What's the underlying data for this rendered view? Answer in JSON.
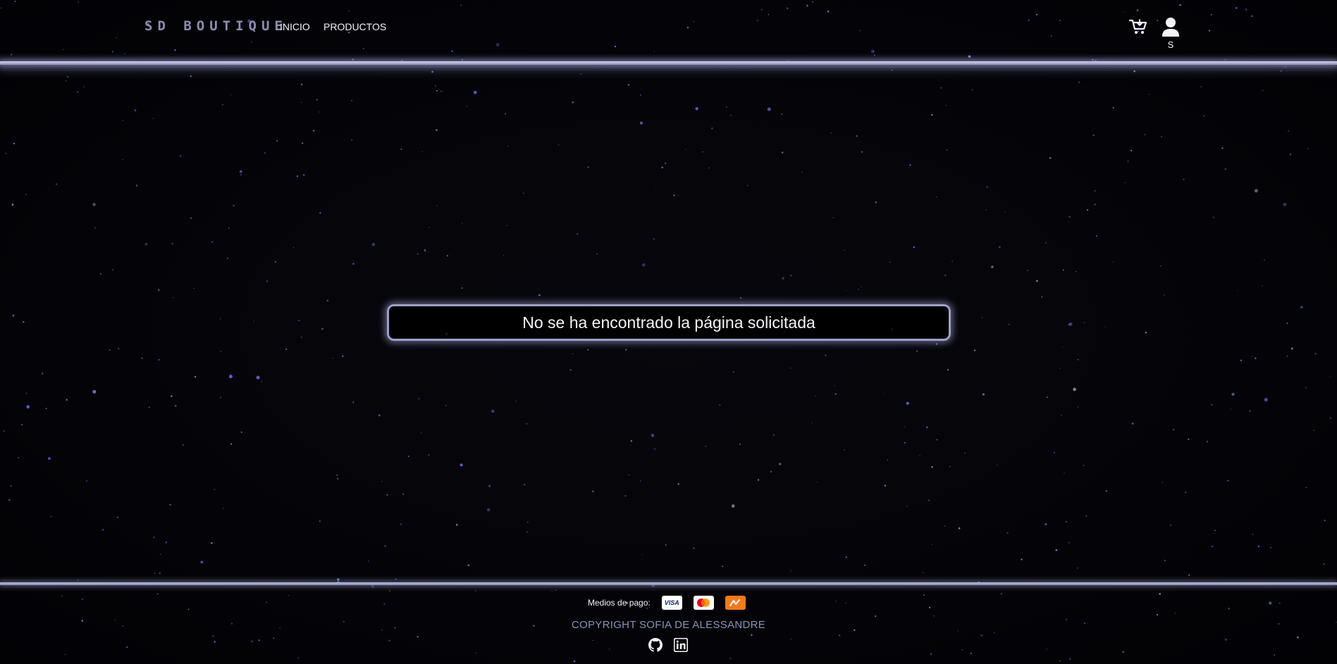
{
  "header": {
    "brand": "SD BOUTIQUE",
    "nav": [
      {
        "label": "INICIO"
      },
      {
        "label": "PRODUCTOS"
      }
    ],
    "cart_icon": "cart-icon",
    "user_icon": "user-icon",
    "user_initial": "S"
  },
  "main": {
    "message": "No se ha encontrado la página solicitada"
  },
  "footer": {
    "payments_label": "Medios de pago:",
    "payment_methods": [
      {
        "name": "VISA",
        "icon": "visa-icon",
        "color": "#ffffff"
      },
      {
        "icon": "mastercard-icon",
        "color": "#ffffff"
      },
      {
        "icon": "mercadopago-icon",
        "color": "#f47a1a"
      }
    ],
    "copyright": "COPYRIGHT SOFIA DE ALESSANDRE",
    "social": [
      {
        "icon": "github-icon"
      },
      {
        "icon": "linkedin-icon"
      }
    ]
  },
  "colors": {
    "background": "#030307",
    "accent": "#9da0c6",
    "brand": "#8b8fb3",
    "text": "#f2f2f7"
  }
}
